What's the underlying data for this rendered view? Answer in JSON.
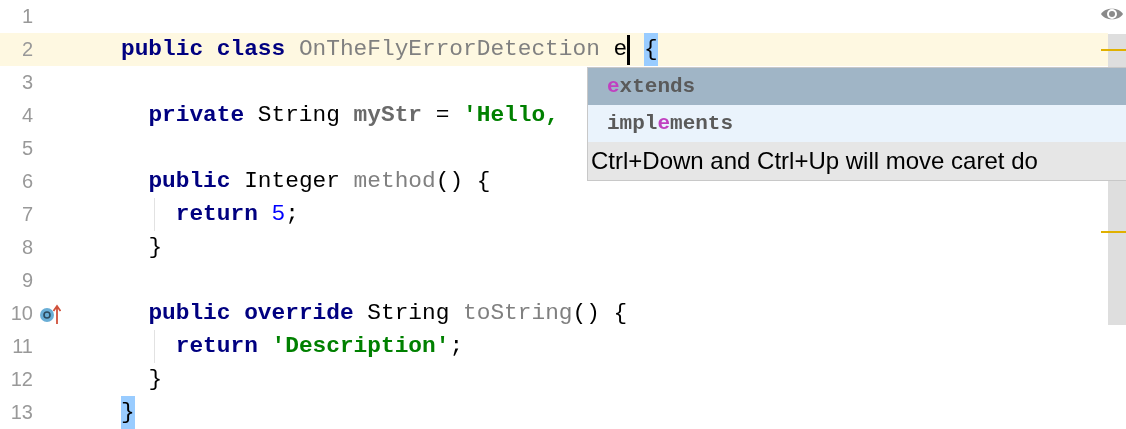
{
  "editor": {
    "lines": [
      {
        "number": "1"
      },
      {
        "number": "2",
        "current": true,
        "tokens": [
          {
            "kind": "keyword",
            "text": "public "
          },
          {
            "kind": "keyword",
            "text": "class "
          },
          {
            "kind": "declaration",
            "text": "OnTheFlyErrorDetection "
          },
          {
            "kind": "plain",
            "text": "e"
          },
          {
            "kind": "caret"
          },
          {
            "kind": "brace",
            "text": "{",
            "matched": true
          }
        ]
      },
      {
        "number": "3"
      },
      {
        "number": "4",
        "tokens": [
          {
            "kind": "keyword",
            "text": "  private "
          },
          {
            "kind": "plain",
            "text": "String "
          },
          {
            "kind": "field",
            "text": "myStr "
          },
          {
            "kind": "plain",
            "text": "= "
          },
          {
            "kind": "string",
            "text": "'Hello, "
          }
        ]
      },
      {
        "number": "5"
      },
      {
        "number": "6",
        "tokens": [
          {
            "kind": "keyword",
            "text": "  public "
          },
          {
            "kind": "plain",
            "text": "Integer "
          },
          {
            "kind": "declaration",
            "text": "method"
          },
          {
            "kind": "plain",
            "text": "() {"
          }
        ]
      },
      {
        "number": "7",
        "guide": true,
        "tokens": [
          {
            "kind": "keyword",
            "text": "    return "
          },
          {
            "kind": "number",
            "text": "5"
          },
          {
            "kind": "plain",
            "text": ";"
          }
        ]
      },
      {
        "number": "8",
        "tokens": [
          {
            "kind": "plain",
            "text": "  }"
          }
        ]
      },
      {
        "number": "9"
      },
      {
        "number": "10",
        "override_marker": true,
        "tokens": [
          {
            "kind": "keyword",
            "text": "  public "
          },
          {
            "kind": "keyword",
            "text": "override "
          },
          {
            "kind": "plain",
            "text": "String "
          },
          {
            "kind": "declaration",
            "text": "toString"
          },
          {
            "kind": "plain",
            "text": "() {"
          }
        ]
      },
      {
        "number": "11",
        "guide": true,
        "tokens": [
          {
            "kind": "keyword",
            "text": "    return "
          },
          {
            "kind": "string",
            "text": "'Description'"
          },
          {
            "kind": "plain",
            "text": ";"
          }
        ]
      },
      {
        "number": "12",
        "tokens": [
          {
            "kind": "plain",
            "text": "  }"
          }
        ]
      },
      {
        "number": "13",
        "tokens": [
          {
            "kind": "brace",
            "text": "}",
            "matched": true
          }
        ]
      }
    ]
  },
  "completion": {
    "items": [
      {
        "selected": true,
        "parts": [
          {
            "text": "e",
            "match": true
          },
          {
            "text": "xtends",
            "match": false
          }
        ]
      },
      {
        "selected": false,
        "parts": [
          {
            "text": "impl",
            "match": false
          },
          {
            "text": "e",
            "match": true
          },
          {
            "text": "ments",
            "match": false
          }
        ]
      }
    ],
    "hint": "Ctrl+Down and Ctrl+Up will move caret do"
  }
}
